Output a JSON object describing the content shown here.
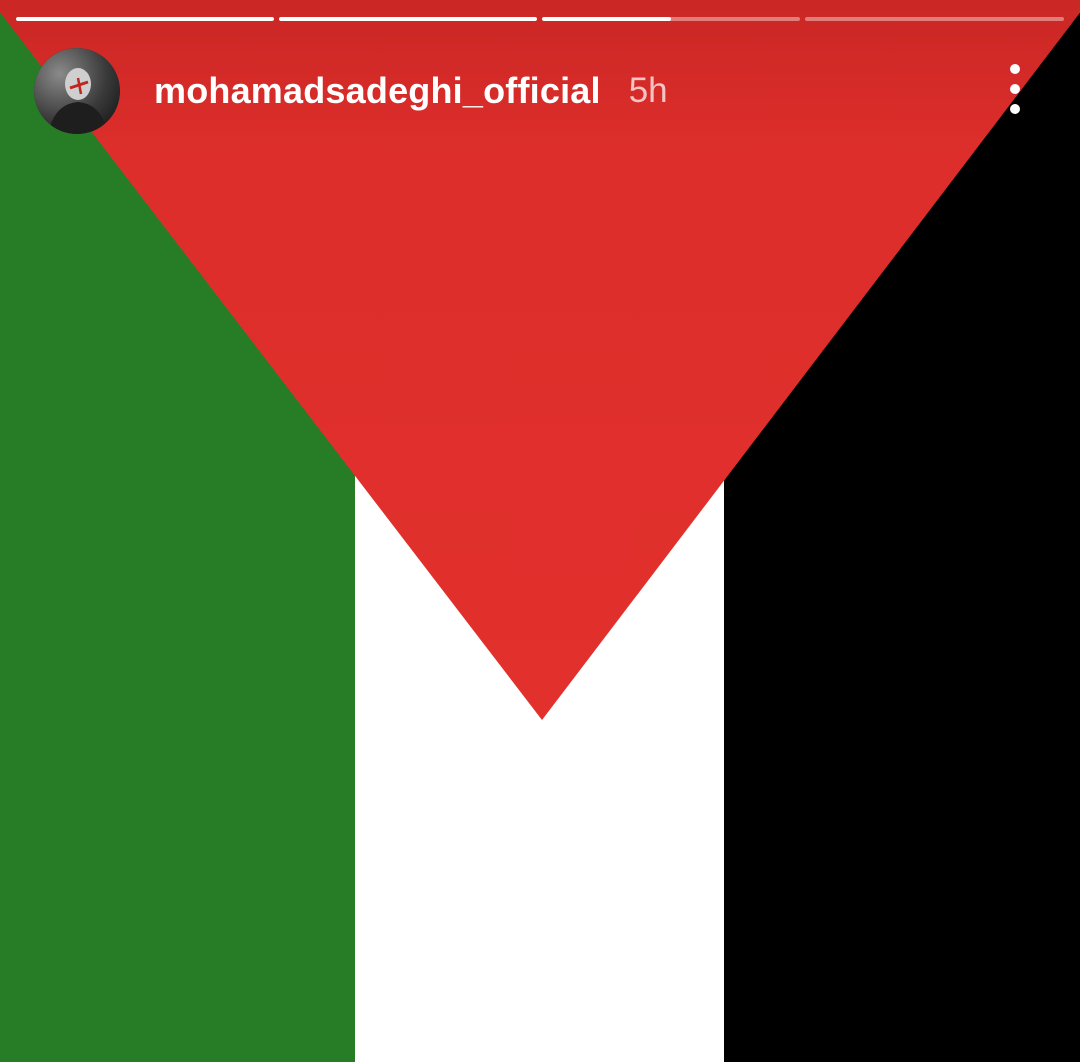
{
  "story": {
    "username": "mohamadsadeghi_official",
    "time_ago": "5h",
    "progress": [
      1,
      1,
      0.5,
      0
    ],
    "image": {
      "description_icon": "palestine-flag",
      "colors": {
        "green": "#267d25",
        "white": "#ffffff",
        "black": "#000000",
        "red": "#e2302c"
      }
    }
  },
  "icons": {
    "more": "more-vertical-icon",
    "avatar": "profile-avatar"
  }
}
